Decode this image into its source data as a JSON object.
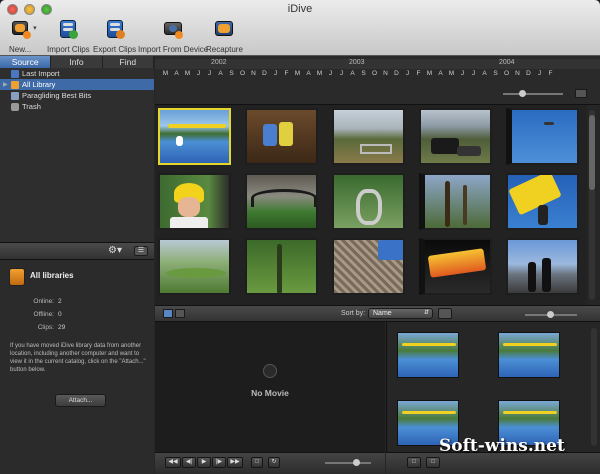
{
  "window": {
    "title": "iDive"
  },
  "toolbar": {
    "new_label": "New...",
    "import_clips_label": "Import Clips",
    "export_clips_label": "Export Clips",
    "import_device_label": "Import From Device",
    "recapture_label": "Recapture"
  },
  "tabs": [
    {
      "label": "Source",
      "active": true
    },
    {
      "label": "Info",
      "active": false
    },
    {
      "label": "Find",
      "active": false
    }
  ],
  "source_list": [
    {
      "label": "Last Import",
      "selected": false,
      "icon": "clip-icon"
    },
    {
      "label": "All Library",
      "selected": true,
      "icon": "library-icon"
    },
    {
      "label": "Paragliding Best Bits",
      "selected": false,
      "icon": "folder-icon"
    },
    {
      "label": "Trash",
      "selected": false,
      "icon": "trash-icon"
    }
  ],
  "library_info": {
    "title": "All libraries",
    "online_label": "Online:",
    "online_value": "2",
    "offline_label": "Offline:",
    "offline_value": "0",
    "clips_label": "Clips:",
    "clips_value": "29",
    "note": "If you have moved iDive library data from another location, including another computer and want to view it in the current catalog, click on the \"Attach...\" button below.",
    "attach_label": "Attach..."
  },
  "timeline": {
    "years": [
      "2002",
      "2003",
      "2004"
    ],
    "months": [
      "M",
      "A",
      "M",
      "J",
      "J",
      "A",
      "S",
      "O",
      "N",
      "D",
      "J",
      "F",
      "M",
      "A",
      "M",
      "J",
      "J",
      "A",
      "S",
      "O",
      "N",
      "D",
      "J",
      "F",
      "M",
      "A",
      "M",
      "J",
      "J",
      "A",
      "S",
      "O",
      "N",
      "D",
      "J",
      "F"
    ]
  },
  "sort": {
    "label": "Sort by:",
    "value": "Name"
  },
  "viewer": {
    "empty_text": "No Movie"
  },
  "watermark": "Soft-wins.net",
  "colors": {
    "selection": "#3f6aa8",
    "clip_highlight": "#e6d62c",
    "background": "#262626"
  }
}
